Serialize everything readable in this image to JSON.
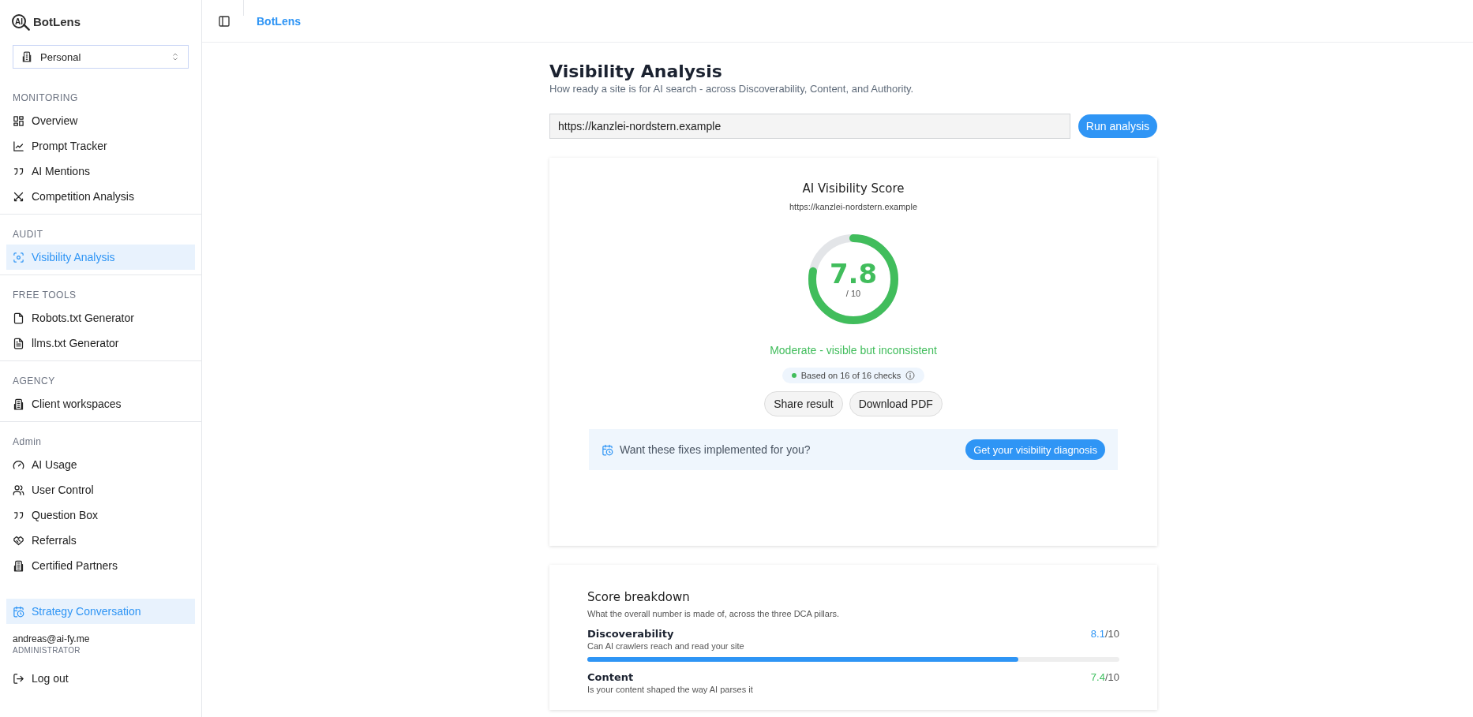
{
  "sidebar": {
    "logo_mark": "AI",
    "brand": "BotLens",
    "workspace_select": {
      "value": "Personal"
    },
    "sections": [
      {
        "title": "MONITORING",
        "items": [
          {
            "label": "Overview",
            "selected": false
          },
          {
            "label": "Prompt Tracker",
            "selected": false
          },
          {
            "label": "AI Mentions",
            "selected": false
          },
          {
            "label": "Competition Analysis",
            "selected": false
          }
        ]
      },
      {
        "title": "AUDIT",
        "items": [
          {
            "label": "Visibility Analysis",
            "selected": true
          }
        ]
      },
      {
        "title": "FREE TOOLS",
        "items": [
          {
            "label": "Robots.txt Generator",
            "selected": false
          },
          {
            "label": "llms.txt Generator",
            "selected": false
          }
        ]
      },
      {
        "title": "AGENCY",
        "items": [
          {
            "label": "Client workspaces",
            "selected": false
          }
        ]
      },
      {
        "title": "Admin",
        "items": [
          {
            "label": "AI Usage",
            "selected": false
          },
          {
            "label": "User Control",
            "selected": false
          },
          {
            "label": "Question Box",
            "selected": false
          },
          {
            "label": "Referrals",
            "selected": false
          },
          {
            "label": "Certified Partners",
            "selected": false
          }
        ]
      }
    ],
    "footer_item": {
      "label": "Strategy Conversation",
      "selected": true
    },
    "user": {
      "email": "andreas@ai-fy.me",
      "role": "ADMINISTRATOR"
    },
    "logout": "Log out"
  },
  "header": {
    "breadcrumb": "BotLens"
  },
  "main": {
    "title": "Visibility Analysis",
    "subtitle": "How ready a site is for AI search - across Discoverability, Content, and Authority.",
    "url_input": {
      "value": "https://kanzlei-nordstern.example"
    },
    "run_button": "Run analysis",
    "score_card": {
      "title": "AI Visibility Score",
      "url": "https://kanzlei-nordstern.example",
      "score": "7.8",
      "out_of": "/ 10",
      "level": 0.78,
      "verdict": "Moderate - visible but inconsistent",
      "checks": "Based on 16 of 16 checks",
      "buttons": [
        "Share result",
        "Download PDF"
      ],
      "cta": {
        "text": "Want these fixes implemented for you?",
        "button": "Get your visibility diagnosis"
      }
    },
    "breakdown": {
      "title": "Score breakdown",
      "description": "What the overall number is made of, across the three DCA pillars.",
      "pillars": [
        {
          "name": "Discoverability",
          "description": "Can AI crawlers reach and read your site",
          "score": "8.1",
          "out_of": "/10",
          "color": "#2f95f5",
          "level": 0.81
        },
        {
          "name": "Content",
          "description": "Is your content shaped the way AI parses it",
          "score": "7.4",
          "out_of": "/10",
          "color": "#3fbf5f"
        }
      ]
    }
  }
}
